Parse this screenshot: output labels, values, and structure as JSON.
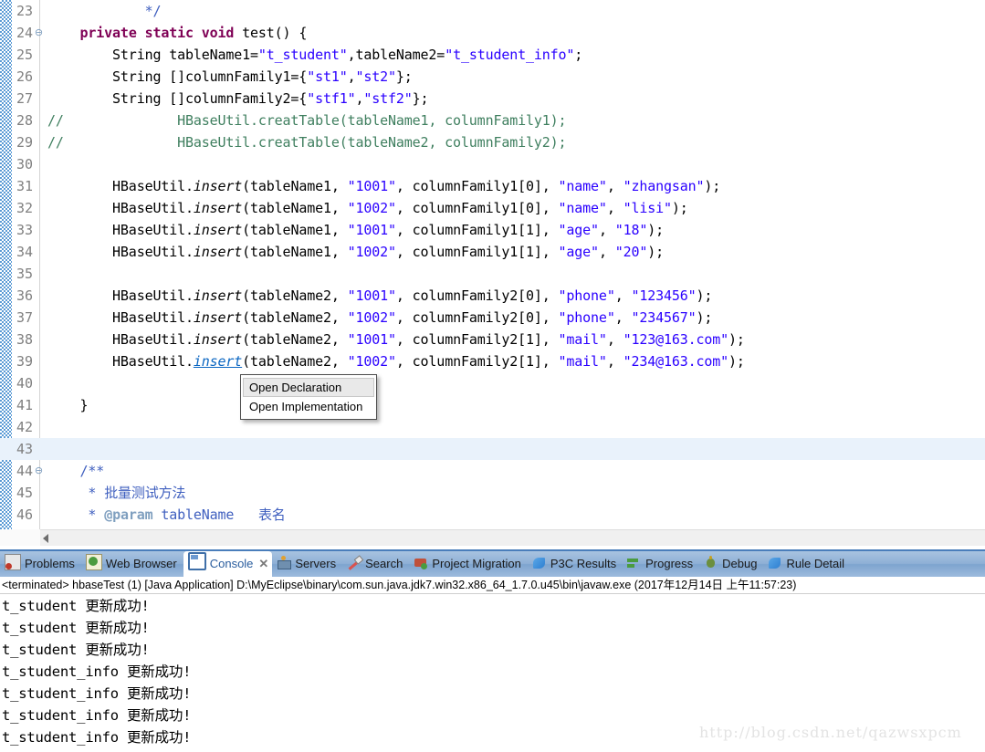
{
  "editor": {
    "current_line": 43,
    "lines": [
      {
        "n": 23,
        "fold": false,
        "indent": 3,
        "tokens": [
          {
            "t": "*/",
            "c": "jdoc"
          }
        ]
      },
      {
        "n": 24,
        "fold": true,
        "indent": 1,
        "tokens": [
          {
            "t": "private static void ",
            "c": "kw"
          },
          {
            "t": "test() {",
            "c": ""
          }
        ]
      },
      {
        "n": 25,
        "fold": false,
        "indent": 2,
        "tokens": [
          {
            "t": "String tableName1=",
            "c": ""
          },
          {
            "t": "\"t_student\"",
            "c": "str"
          },
          {
            "t": ",tableName2=",
            "c": ""
          },
          {
            "t": "\"t_student_info\"",
            "c": "str"
          },
          {
            "t": ";",
            "c": ""
          }
        ]
      },
      {
        "n": 26,
        "fold": false,
        "indent": 2,
        "tokens": [
          {
            "t": "String []columnFamily1={",
            "c": ""
          },
          {
            "t": "\"st1\"",
            "c": "str"
          },
          {
            "t": ",",
            "c": ""
          },
          {
            "t": "\"st2\"",
            "c": "str"
          },
          {
            "t": "};",
            "c": ""
          }
        ]
      },
      {
        "n": 27,
        "fold": false,
        "indent": 2,
        "tokens": [
          {
            "t": "String []columnFamily2={",
            "c": ""
          },
          {
            "t": "\"stf1\"",
            "c": "str"
          },
          {
            "t": ",",
            "c": ""
          },
          {
            "t": "\"stf2\"",
            "c": "str"
          },
          {
            "t": "};",
            "c": ""
          }
        ]
      },
      {
        "n": 28,
        "fold": false,
        "indent": 0,
        "prefix": "//",
        "tokens": [
          {
            "t": "  \t\tHBaseUtil.creatTable(tableName1, columnFamily1);",
            "c": "cmt"
          }
        ]
      },
      {
        "n": 29,
        "fold": false,
        "indent": 0,
        "prefix": "//",
        "tokens": [
          {
            "t": "  \t\tHBaseUtil.creatTable(tableName2, columnFamily2);",
            "c": "cmt"
          }
        ]
      },
      {
        "n": 30,
        "fold": false,
        "indent": 0,
        "tokens": []
      },
      {
        "n": 31,
        "fold": false,
        "indent": 2,
        "tokens": [
          {
            "t": "HBaseUtil.",
            "c": ""
          },
          {
            "t": "insert",
            "c": "stat"
          },
          {
            "t": "(tableName1, ",
            "c": ""
          },
          {
            "t": "\"1001\"",
            "c": "str"
          },
          {
            "t": ", columnFamily1[0], ",
            "c": ""
          },
          {
            "t": "\"name\"",
            "c": "str"
          },
          {
            "t": ", ",
            "c": ""
          },
          {
            "t": "\"zhangsan\"",
            "c": "str"
          },
          {
            "t": ");",
            "c": ""
          }
        ]
      },
      {
        "n": 32,
        "fold": false,
        "indent": 2,
        "tokens": [
          {
            "t": "HBaseUtil.",
            "c": ""
          },
          {
            "t": "insert",
            "c": "stat"
          },
          {
            "t": "(tableName1, ",
            "c": ""
          },
          {
            "t": "\"1002\"",
            "c": "str"
          },
          {
            "t": ", columnFamily1[0], ",
            "c": ""
          },
          {
            "t": "\"name\"",
            "c": "str"
          },
          {
            "t": ", ",
            "c": ""
          },
          {
            "t": "\"lisi\"",
            "c": "str"
          },
          {
            "t": ");",
            "c": ""
          }
        ]
      },
      {
        "n": 33,
        "fold": false,
        "indent": 2,
        "tokens": [
          {
            "t": "HBaseUtil.",
            "c": ""
          },
          {
            "t": "insert",
            "c": "stat"
          },
          {
            "t": "(tableName1, ",
            "c": ""
          },
          {
            "t": "\"1001\"",
            "c": "str"
          },
          {
            "t": ", columnFamily1[1], ",
            "c": ""
          },
          {
            "t": "\"age\"",
            "c": "str"
          },
          {
            "t": ", ",
            "c": ""
          },
          {
            "t": "\"18\"",
            "c": "str"
          },
          {
            "t": ");",
            "c": ""
          }
        ]
      },
      {
        "n": 34,
        "fold": false,
        "indent": 2,
        "tokens": [
          {
            "t": "HBaseUtil.",
            "c": ""
          },
          {
            "t": "insert",
            "c": "stat"
          },
          {
            "t": "(tableName1, ",
            "c": ""
          },
          {
            "t": "\"1002\"",
            "c": "str"
          },
          {
            "t": ", columnFamily1[1], ",
            "c": ""
          },
          {
            "t": "\"age\"",
            "c": "str"
          },
          {
            "t": ", ",
            "c": ""
          },
          {
            "t": "\"20\"",
            "c": "str"
          },
          {
            "t": ");",
            "c": ""
          }
        ]
      },
      {
        "n": 35,
        "fold": false,
        "indent": 0,
        "tokens": []
      },
      {
        "n": 36,
        "fold": false,
        "indent": 2,
        "tokens": [
          {
            "t": "HBaseUtil.",
            "c": ""
          },
          {
            "t": "insert",
            "c": "stat"
          },
          {
            "t": "(tableName2, ",
            "c": ""
          },
          {
            "t": "\"1001\"",
            "c": "str"
          },
          {
            "t": ", columnFamily2[0], ",
            "c": ""
          },
          {
            "t": "\"phone\"",
            "c": "str"
          },
          {
            "t": ", ",
            "c": ""
          },
          {
            "t": "\"123456\"",
            "c": "str"
          },
          {
            "t": ");",
            "c": ""
          }
        ]
      },
      {
        "n": 37,
        "fold": false,
        "indent": 2,
        "tokens": [
          {
            "t": "HBaseUtil.",
            "c": ""
          },
          {
            "t": "insert",
            "c": "stat"
          },
          {
            "t": "(tableName2, ",
            "c": ""
          },
          {
            "t": "\"1002\"",
            "c": "str"
          },
          {
            "t": ", columnFamily2[0], ",
            "c": ""
          },
          {
            "t": "\"phone\"",
            "c": "str"
          },
          {
            "t": ", ",
            "c": ""
          },
          {
            "t": "\"234567\"",
            "c": "str"
          },
          {
            "t": ");",
            "c": ""
          }
        ]
      },
      {
        "n": 38,
        "fold": false,
        "indent": 2,
        "tokens": [
          {
            "t": "HBaseUtil.",
            "c": ""
          },
          {
            "t": "insert",
            "c": "stat"
          },
          {
            "t": "(tableName2, ",
            "c": ""
          },
          {
            "t": "\"1001\"",
            "c": "str"
          },
          {
            "t": ", columnFamily2[1], ",
            "c": ""
          },
          {
            "t": "\"mail\"",
            "c": "str"
          },
          {
            "t": ", ",
            "c": ""
          },
          {
            "t": "\"123@163.com\"",
            "c": "str"
          },
          {
            "t": ");",
            "c": ""
          }
        ]
      },
      {
        "n": 39,
        "fold": false,
        "indent": 2,
        "tokens": [
          {
            "t": "HBaseUtil.",
            "c": ""
          },
          {
            "t": "insert",
            "c": "link"
          },
          {
            "t": "(tableName2, ",
            "c": ""
          },
          {
            "t": "\"1002\"",
            "c": "str"
          },
          {
            "t": ", columnFamily2[1], ",
            "c": ""
          },
          {
            "t": "\"mail\"",
            "c": "str"
          },
          {
            "t": ", ",
            "c": ""
          },
          {
            "t": "\"234@163.com\"",
            "c": "str"
          },
          {
            "t": ");",
            "c": ""
          }
        ]
      },
      {
        "n": 40,
        "fold": false,
        "indent": 0,
        "tokens": []
      },
      {
        "n": 41,
        "fold": false,
        "indent": 1,
        "tokens": [
          {
            "t": "}",
            "c": ""
          }
        ]
      },
      {
        "n": 42,
        "fold": false,
        "indent": 0,
        "tokens": []
      },
      {
        "n": 43,
        "fold": false,
        "indent": 0,
        "tokens": []
      },
      {
        "n": 44,
        "fold": true,
        "indent": 1,
        "tokens": [
          {
            "t": "/**",
            "c": "jdoc"
          }
        ]
      },
      {
        "n": 45,
        "fold": false,
        "indent": 1,
        "tokens": [
          {
            "t": " * ",
            "c": "jdoc"
          },
          {
            "t": "批量测试方法",
            "c": "jdoc"
          }
        ]
      },
      {
        "n": 46,
        "fold": false,
        "indent": 1,
        "tokens": [
          {
            "t": " * ",
            "c": "jdoc"
          },
          {
            "t": "@param",
            "c": "jdtag"
          },
          {
            "t": " tableName   ",
            "c": "jdoc"
          },
          {
            "t": "表名",
            "c": "jdoc"
          }
        ]
      }
    ]
  },
  "context_menu": {
    "items": [
      {
        "label": "Open Declaration",
        "selected": true
      },
      {
        "label": "Open Implementation",
        "selected": false
      }
    ]
  },
  "bottom_panel": {
    "tabs": [
      {
        "label": "Problems",
        "icon": "problems-icon",
        "active": false,
        "closable": false
      },
      {
        "label": "Web Browser",
        "icon": "browser-icon",
        "active": false,
        "closable": false
      },
      {
        "label": "Console",
        "icon": "console-icon",
        "active": true,
        "closable": true,
        "close_glyph": "✕"
      },
      {
        "label": "Servers",
        "icon": "servers-icon",
        "active": false,
        "closable": false
      },
      {
        "label": "Search",
        "icon": "search-icon",
        "active": false,
        "closable": false
      },
      {
        "label": "Project Migration",
        "icon": "migration-icon",
        "active": false,
        "closable": false
      },
      {
        "label": "P3C Results",
        "icon": "p3c-icon",
        "active": false,
        "closable": false
      },
      {
        "label": "Progress",
        "icon": "progress-icon",
        "active": false,
        "closable": false
      },
      {
        "label": "Debug",
        "icon": "debug-icon",
        "active": false,
        "closable": false
      },
      {
        "label": "Rule Detail",
        "icon": "ruledetail-icon",
        "active": false,
        "closable": false
      }
    ],
    "launch_line": "<terminated> hbaseTest (1) [Java Application] D:\\MyEclipse\\binary\\com.sun.java.jdk7.win32.x86_64_1.7.0.u45\\bin\\javaw.exe (2017年12月14日 上午11:57:23)",
    "console_lines": [
      "t_student 更新成功!",
      "t_student 更新成功!",
      "t_student 更新成功!",
      "t_student_info 更新成功!",
      "t_student_info 更新成功!",
      "t_student_info 更新成功!",
      "t_student_info 更新成功!"
    ]
  },
  "watermark": {
    "text": "http://blog.csdn.net/qazwsxpcm"
  },
  "colors": {
    "keyword": "#7f0055",
    "string": "#2a00ff",
    "comment": "#3f7f5f",
    "javadoc": "#3f5fbf",
    "javadoc_tag": "#7f9fbf",
    "hyperlink": "#0a66c2",
    "current_line_highlight": "#e9f2fb",
    "tabbar": "#8fb0d6",
    "active_tab_text": "#2a5d9e"
  }
}
